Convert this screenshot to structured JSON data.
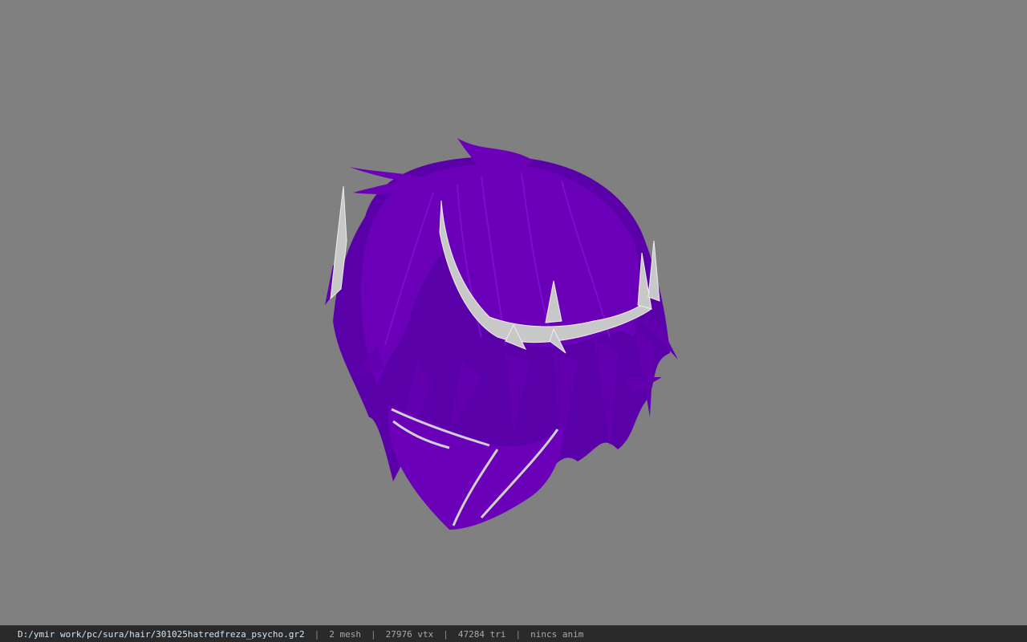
{
  "viewer": {
    "background_color": "#808080",
    "model": {
      "hair_color": "#6a00b8",
      "hair_shade": "#4a0088",
      "accent_color": "#c8c8c8",
      "icon": "hair-model-icon"
    }
  },
  "statusbar": {
    "file_path": "D:/ymir work/pc/sura/hair/301025hatredfreza_psycho.gr2",
    "separator": "|",
    "mesh": "2 mesh",
    "vertices": "27976 vtx",
    "triangles": "47284 tri",
    "animation": "nincs anim"
  }
}
